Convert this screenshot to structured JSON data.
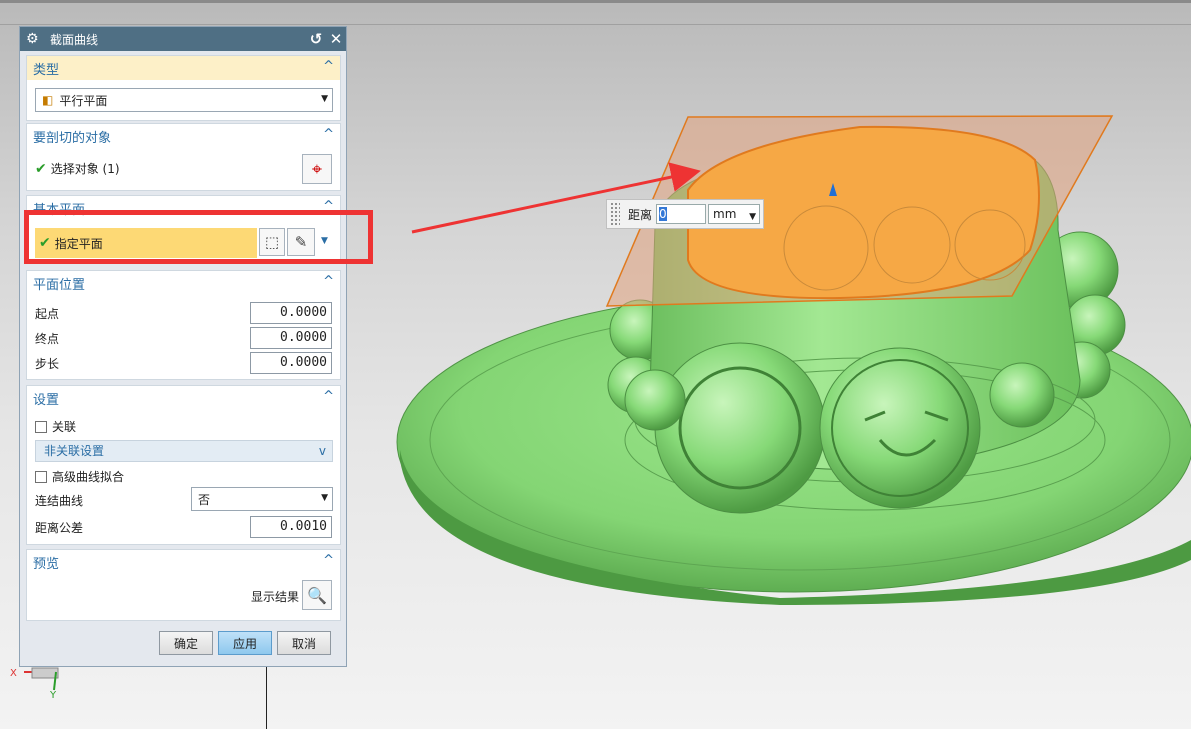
{
  "dialog": {
    "title": "截面曲线",
    "type_group": {
      "header": "类型",
      "selected": "平行平面"
    },
    "objects_group": {
      "header": "要剖切的对象",
      "select_label": "选择对象 (1)"
    },
    "base_plane_group": {
      "header": "基本平面",
      "specify_label": "指定平面"
    },
    "plane_position_group": {
      "header": "平面位置",
      "fields": [
        {
          "label": "起点",
          "value": "0.0000"
        },
        {
          "label": "终点",
          "value": "0.0000"
        },
        {
          "label": "步长",
          "value": "0.0000"
        }
      ]
    },
    "settings_group": {
      "header": "设置",
      "associative_label": "关联",
      "nonassoc_settings_label": "非关联设置",
      "advanced_fit_label": "高级曲线拟合",
      "join_curves_label": "连结曲线",
      "join_curves_value": "否",
      "distance_tol_label": "距离公差",
      "distance_tol_value": "0.0010"
    },
    "preview_group": {
      "header": "预览",
      "show_result_label": "显示结果"
    },
    "buttons": {
      "ok": "确定",
      "apply": "应用",
      "cancel": "取消"
    }
  },
  "distance_input": {
    "label": "距离",
    "value": "0",
    "unit": "mm"
  },
  "axis": {
    "x_label": "X",
    "y_label": "Y"
  },
  "colors": {
    "title_bar": "#4f6f84",
    "group_header": "#2b6ea5",
    "highlight_row": "#fdd975",
    "red_box": "#ee3333",
    "model_green": "#86d977",
    "plane_orange": "#f2a54a"
  }
}
